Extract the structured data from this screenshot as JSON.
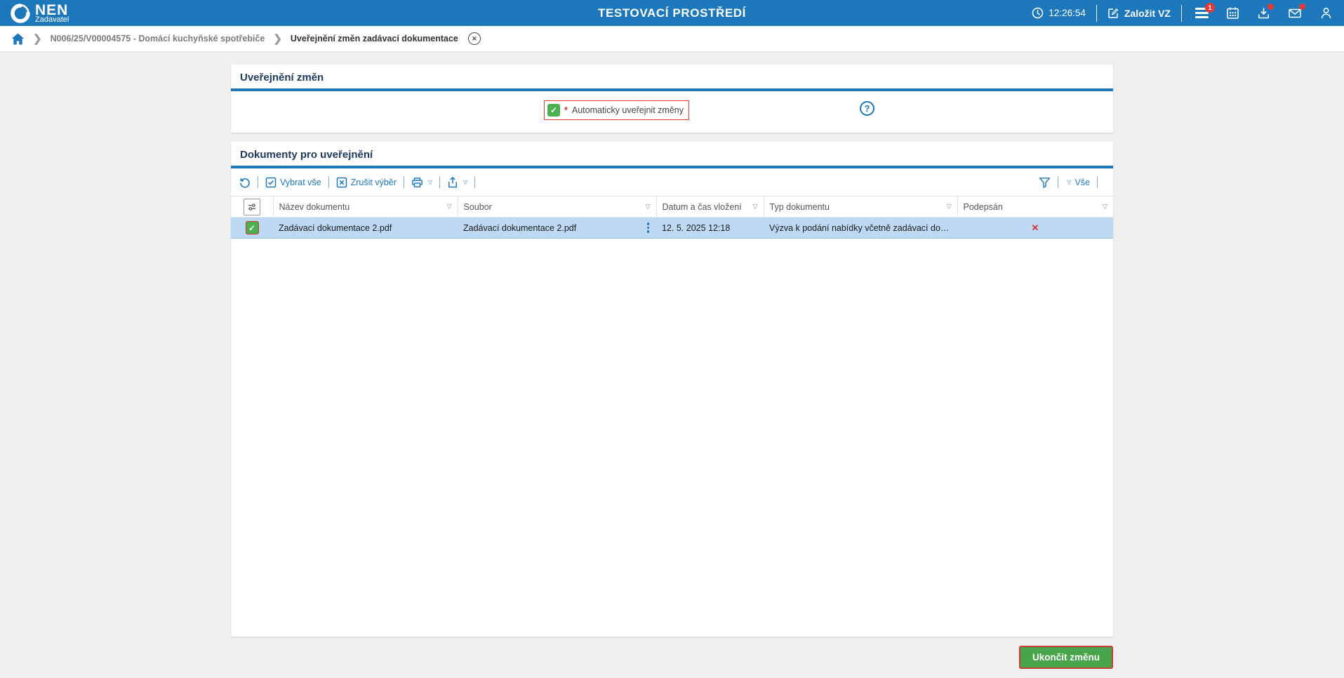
{
  "header": {
    "logo": "NEN",
    "logo_sub": "Zadavatel",
    "environment_title": "TESTOVACÍ PROSTŘEDÍ",
    "time": "12:26:54",
    "create_button": "Založit VZ",
    "menu_badge": "1"
  },
  "breadcrumb": {
    "procurement": "N006/25/V00004575 - Domácí kuchyňské spotřebiče",
    "current": "Uveřejnění změn zadávací dokumentace"
  },
  "section_publish": {
    "title": "Uveřejnění změn",
    "required_marker": "*",
    "checkbox_label": "Automaticky uveřejnit změny",
    "checked": true
  },
  "section_documents": {
    "title": "Dokumenty pro uveřejnění",
    "toolbar": {
      "select_all": "Vybrat vše",
      "clear_selection": "Zrušit výběr",
      "filter_all": "Vše"
    },
    "table": {
      "columns": [
        "Název dokumentu",
        "Soubor",
        "Datum a čas vložení",
        "Typ dokumentu",
        "Podepsán"
      ],
      "rows": [
        {
          "nazev": "Zadávací dokumentace 2.pdf",
          "soubor": "Zadávací dokumentace 2.pdf",
          "datum": "12. 5. 2025 12:18",
          "typ": "Výzva k podání nabídky včetně zadávací do…",
          "podepsan": false
        }
      ]
    }
  },
  "footer": {
    "finish_button": "Ukončit změnu"
  },
  "icons": {
    "check": "✓",
    "not_signed": "✕",
    "question_mark": "?",
    "dropdown_arrow": "▽",
    "breadcrumb_chevron": "❯",
    "close": "✕"
  },
  "colors": {
    "header_blue": "#1d78bb",
    "accent_blue": "#1d78bb",
    "selected_row": "#bdd9f4",
    "checkbox_green": "#4caf50",
    "button_green": "#47a44b",
    "alert_red": "#d8312c",
    "badge_red": "#e53935",
    "page_background": "#efefef"
  }
}
